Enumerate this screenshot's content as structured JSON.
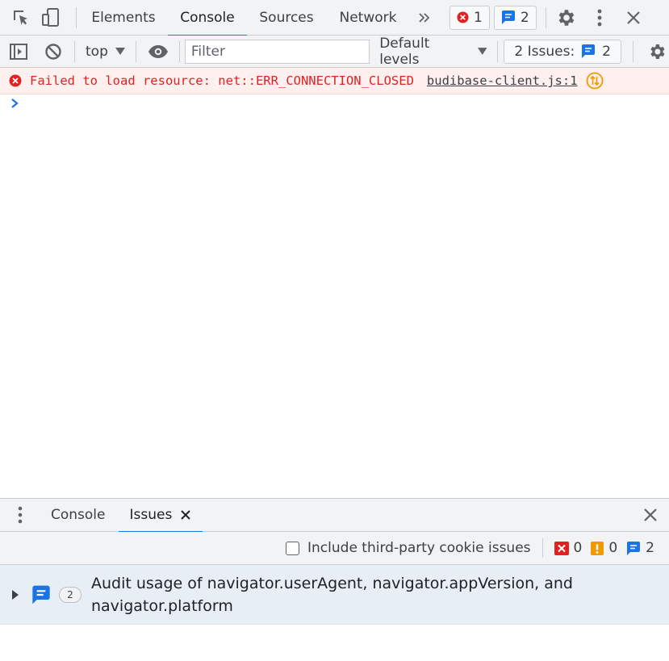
{
  "main_tabs": [
    {
      "label": "Elements"
    },
    {
      "label": "Console"
    },
    {
      "label": "Sources"
    },
    {
      "label": "Network"
    }
  ],
  "counters": {
    "errors": "1",
    "messages": "2"
  },
  "toolbar": {
    "context": "top",
    "filter_placeholder": "Filter",
    "levels": "Default levels",
    "issues_label": "2 Issues:",
    "issues_count": "2"
  },
  "console": {
    "error_message": "Failed to load resource: net::ERR_CONNECTION_CLOSED",
    "error_source": "budibase-client.js:1"
  },
  "drawer": {
    "tabs": [
      {
        "label": "Console"
      },
      {
        "label": "Issues"
      }
    ],
    "third_party_label": "Include third-party cookie issues",
    "counts": {
      "errors": "0",
      "warnings": "0",
      "info": "2"
    },
    "issue": {
      "count": "2",
      "title": "Audit usage of navigator.userAgent, navigator.appVersion, and navigator.platform"
    }
  },
  "colors": {
    "accent": "#1a73e8",
    "error": "#e02222",
    "warning": "#f29900",
    "issue_row_bg": "#e8eef6"
  }
}
